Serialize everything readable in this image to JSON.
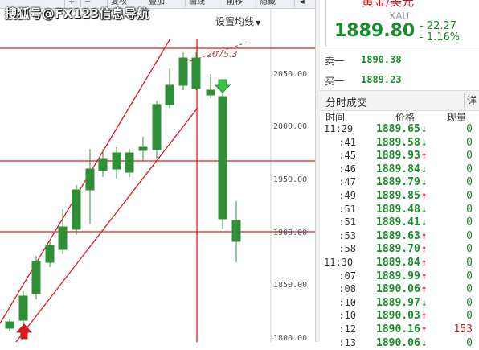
{
  "toolbar": {
    "items": [
      {
        "label": "+"
      },
      {
        "label": "−"
      },
      {
        "label": "复权"
      },
      {
        "label": "叠加"
      },
      {
        "label": "画线"
      },
      {
        "label": "前移"
      },
      {
        "label": "隐藏"
      },
      {
        "label": "◄"
      }
    ]
  },
  "watermark": "搜狐号@FX123信息导航",
  "indicator_button": {
    "label": "设置均线",
    "caret": "▼"
  },
  "chart": {
    "high_label": "2075.3",
    "y_axis_ticks": [
      "2050.00",
      "2000.00",
      "1950.00",
      "1900.00",
      "1850.00",
      "1800.00"
    ],
    "colors": {
      "up": "#2f8f36",
      "down": "#2f8f36",
      "lines": "#e0191f"
    },
    "icons": {
      "buy_marker": "red-up-arrow-icon",
      "sell_marker": "green-down-arrow-icon"
    }
  },
  "quote": {
    "name": "黄金/美元",
    "code": "XAU",
    "price": "1889.80",
    "change": "- 22.27",
    "change_pct": "- 1.16%"
  },
  "ask": {
    "label": "卖一",
    "value": "1890.38"
  },
  "bid": {
    "label": "买一",
    "value": "1889.23"
  },
  "ticks_panel": {
    "title": "分时成交",
    "detail_button": "详",
    "headers": {
      "time": "时间",
      "price": "价格",
      "volume": "现量"
    },
    "rows": [
      {
        "time": "11:29",
        "price": "1889.65",
        "dir": "down",
        "vol": "0"
      },
      {
        "time": ":41",
        "price": "1889.58",
        "dir": "down",
        "vol": "0"
      },
      {
        "time": ":45",
        "price": "1889.93",
        "dir": "up",
        "vol": "0"
      },
      {
        "time": ":46",
        "price": "1889.84",
        "dir": "down",
        "vol": "0"
      },
      {
        "time": ":47",
        "price": "1889.79",
        "dir": "down",
        "vol": "0"
      },
      {
        "time": ":49",
        "price": "1889.85",
        "dir": "up",
        "vol": "0"
      },
      {
        "time": ":51",
        "price": "1889.48",
        "dir": "down",
        "vol": "0"
      },
      {
        "time": ":51",
        "price": "1889.41",
        "dir": "down",
        "vol": "0"
      },
      {
        "time": ":53",
        "price": "1889.63",
        "dir": "up",
        "vol": "0"
      },
      {
        "time": ":58",
        "price": "1889.70",
        "dir": "up",
        "vol": "0"
      },
      {
        "time": "11:30",
        "price": "1889.84",
        "dir": "up",
        "vol": "0"
      },
      {
        "time": ":07",
        "price": "1889.99",
        "dir": "up",
        "vol": "0"
      },
      {
        "time": ":08",
        "price": "1890.06",
        "dir": "up",
        "vol": "0"
      },
      {
        "time": ":10",
        "price": "1889.97",
        "dir": "down",
        "vol": "0"
      },
      {
        "time": ":10",
        "price": "1890.03",
        "dir": "up",
        "vol": "0"
      },
      {
        "time": ":12",
        "price": "1890.16",
        "dir": "up",
        "vol": "153"
      },
      {
        "time": ":13",
        "price": "1890.06",
        "dir": "down",
        "vol": "0"
      }
    ]
  }
}
